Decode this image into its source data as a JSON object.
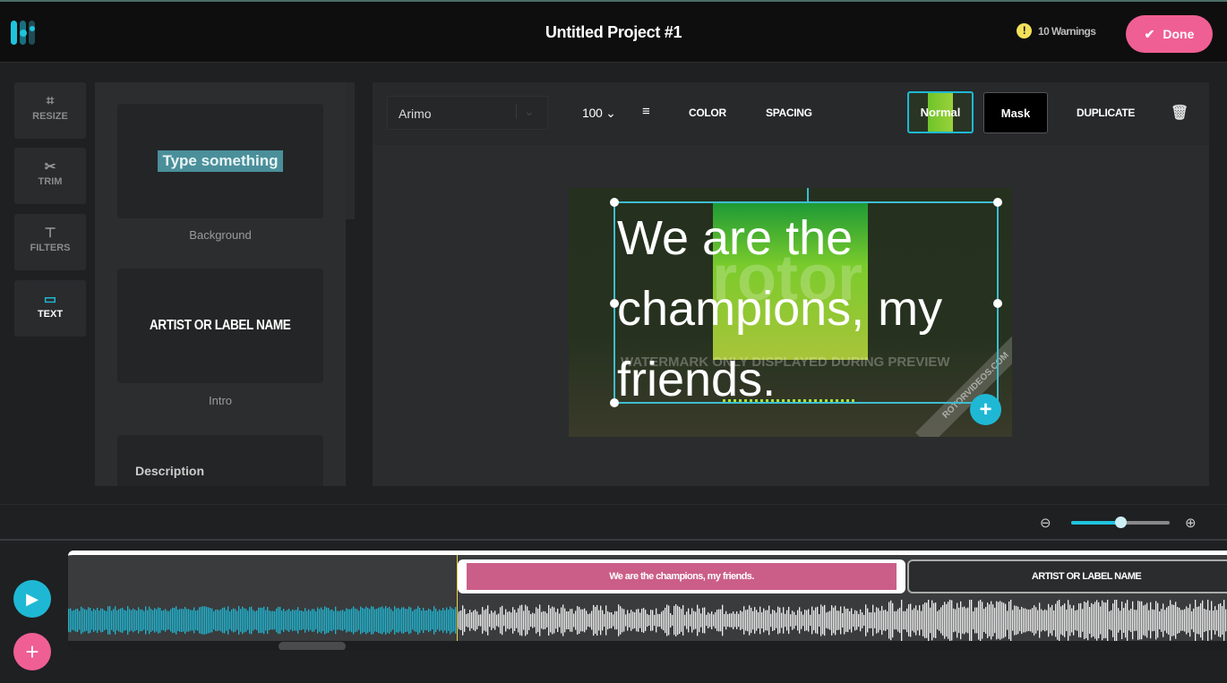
{
  "header": {
    "title": "Untitled Project #1",
    "warnings": "10 Warnings",
    "done_label": "Done"
  },
  "tools": [
    {
      "label": "RESIZE",
      "icon": "crop-icon"
    },
    {
      "label": "TRIM",
      "icon": "scissors-icon"
    },
    {
      "label": "FILTERS",
      "icon": "paint-roller-icon"
    },
    {
      "label": "TEXT",
      "icon": "text-bubble-icon",
      "active": true
    }
  ],
  "templates": [
    {
      "preview": "Type something",
      "label": "Background"
    },
    {
      "preview": "ARTIST OR LABEL NAME",
      "label": "Intro"
    },
    {
      "preview": "Description",
      "label": ""
    }
  ],
  "toolbar": {
    "font": "Arimo",
    "size": "100",
    "color": "COLOR",
    "spacing": "SPACING",
    "normal": "Normal",
    "mask": "Mask",
    "duplicate": "DUPLICATE"
  },
  "preview": {
    "text": "We are the champions, my friends.",
    "watermark": "WATERMARK ONLY DISPLAYED DURING PREVIEW",
    "watermark_logo": "rotor",
    "watermark_url": "ROTORVIDEOS.COM"
  },
  "timeline": {
    "clips": [
      {
        "label": "We are the champions, my friends.",
        "color": "#cb5e88"
      },
      {
        "label": "ARTIST OR LABEL NAME",
        "color": "#2b2c2e"
      }
    ],
    "zoom_level": 0.5,
    "played_fraction": 0.335
  },
  "colors": {
    "accent": "#1fb8d4",
    "pink": "#ef5f93"
  }
}
